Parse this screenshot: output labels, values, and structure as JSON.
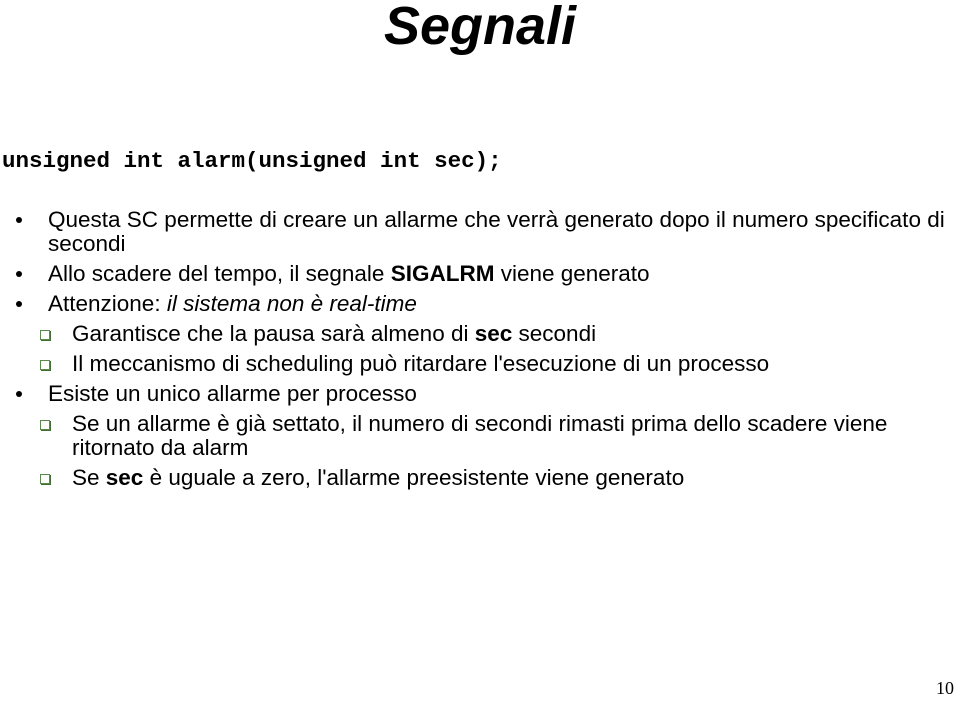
{
  "slide": {
    "title": "Segnali",
    "code_signature": "unsigned int alarm(unsigned int sec);",
    "bullets": [
      {
        "level": 1,
        "parts": [
          {
            "t": "Questa SC permette di creare un allarme che verrà generato dopo il numero specificato di secondi"
          }
        ]
      },
      {
        "level": 1,
        "parts": [
          {
            "t": "Allo scadere del tempo, il segnale "
          },
          {
            "t": "SIGALRM",
            "b": true
          },
          {
            "t": " viene generato"
          }
        ]
      },
      {
        "level": 1,
        "parts": [
          {
            "t": "Attenzione: "
          },
          {
            "t": "il sistema non è real-time",
            "i": true
          }
        ]
      },
      {
        "level": 2,
        "parts": [
          {
            "t": "Garantisce che la pausa sarà almeno di "
          },
          {
            "t": "sec",
            "b": true
          },
          {
            "t": " secondi"
          }
        ]
      },
      {
        "level": 2,
        "parts": [
          {
            "t": "Il meccanismo di scheduling può ritardare l'esecuzione di un processo"
          }
        ]
      },
      {
        "level": 1,
        "parts": [
          {
            "t": "Esiste un unico allarme per processo"
          }
        ]
      },
      {
        "level": 2,
        "parts": [
          {
            "t": "Se un allarme è già settato, il numero di secondi rimasti prima dello scadere viene ritornato da alarm"
          }
        ]
      },
      {
        "level": 2,
        "parts": [
          {
            "t": "Se "
          },
          {
            "t": "sec",
            "b": true
          },
          {
            "t": " è uguale a zero, l'allarme preesistente viene generato"
          }
        ]
      }
    ],
    "page_number": "10",
    "colors": {
      "text": "#000000",
      "sub_bullet": "#5a8a4a",
      "background": "#ffffff"
    }
  }
}
